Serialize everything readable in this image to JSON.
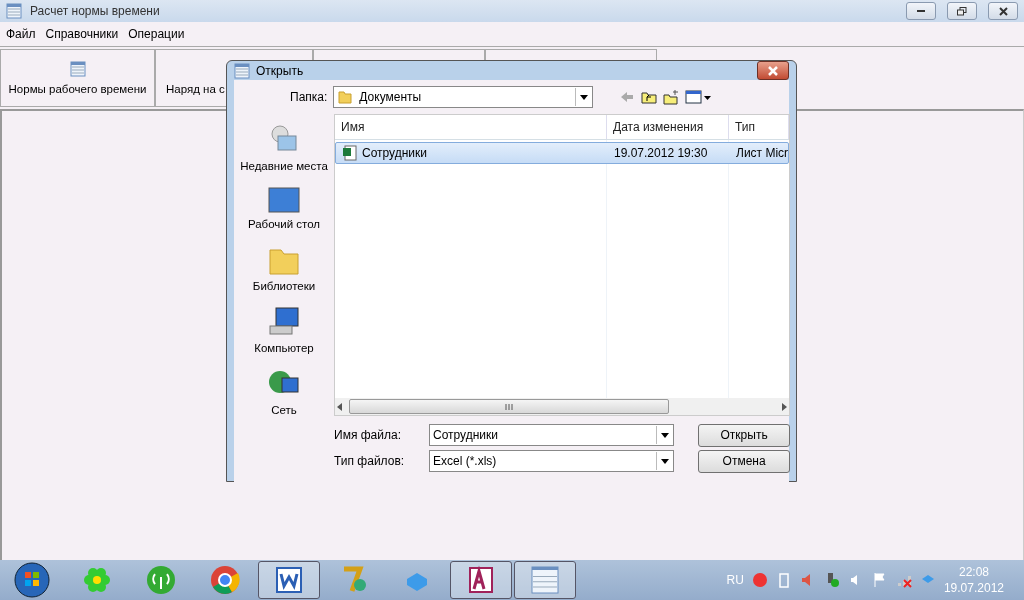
{
  "window": {
    "title": "Расчет нормы времени"
  },
  "menu": [
    "Файл",
    "Справочники",
    "Операции"
  ],
  "toolbar": [
    {
      "label": "Нормы рабочего времени",
      "kind": "icon"
    },
    {
      "label": "Наряд на с",
      "kind": "plain"
    },
    {
      "kind": "blank"
    },
    {
      "kind": "blank"
    }
  ],
  "dialog": {
    "title": "Открыть",
    "folder_label": "Папка:",
    "folder": "Документы",
    "places": [
      {
        "label": "Недавние места",
        "kind": "recent"
      },
      {
        "label": "Рабочий стол",
        "kind": "desktop"
      },
      {
        "label": "Библиотеки",
        "kind": "libraries"
      },
      {
        "label": "Компьютер",
        "kind": "computer"
      },
      {
        "label": "Сеть",
        "kind": "network"
      }
    ],
    "columns": [
      "Имя",
      "Дата изменения",
      "Тип"
    ],
    "files": [
      {
        "name": "Сотрудники",
        "date": "19.07.2012 19:30",
        "type": "Лист Micr",
        "selected": true
      }
    ],
    "filename_label": "Имя файла:",
    "filename": "Сотрудники",
    "filetype_label": "Тип файлов:",
    "filetype": "Excel (*.xls)",
    "buttons": [
      "Открыть",
      "Отмена"
    ]
  },
  "taskbar": {
    "apps": [
      {
        "kind": "flower",
        "active": false
      },
      {
        "kind": "antenna",
        "active": false
      },
      {
        "kind": "browser",
        "active": false
      },
      {
        "kind": "word",
        "active": true
      },
      {
        "kind": "seven",
        "active": false
      },
      {
        "kind": "box",
        "active": false
      },
      {
        "kind": "access",
        "active": true
      },
      {
        "kind": "table",
        "active": true
      }
    ],
    "language": "RU",
    "time": "22:08",
    "date": "19.07.2012"
  }
}
